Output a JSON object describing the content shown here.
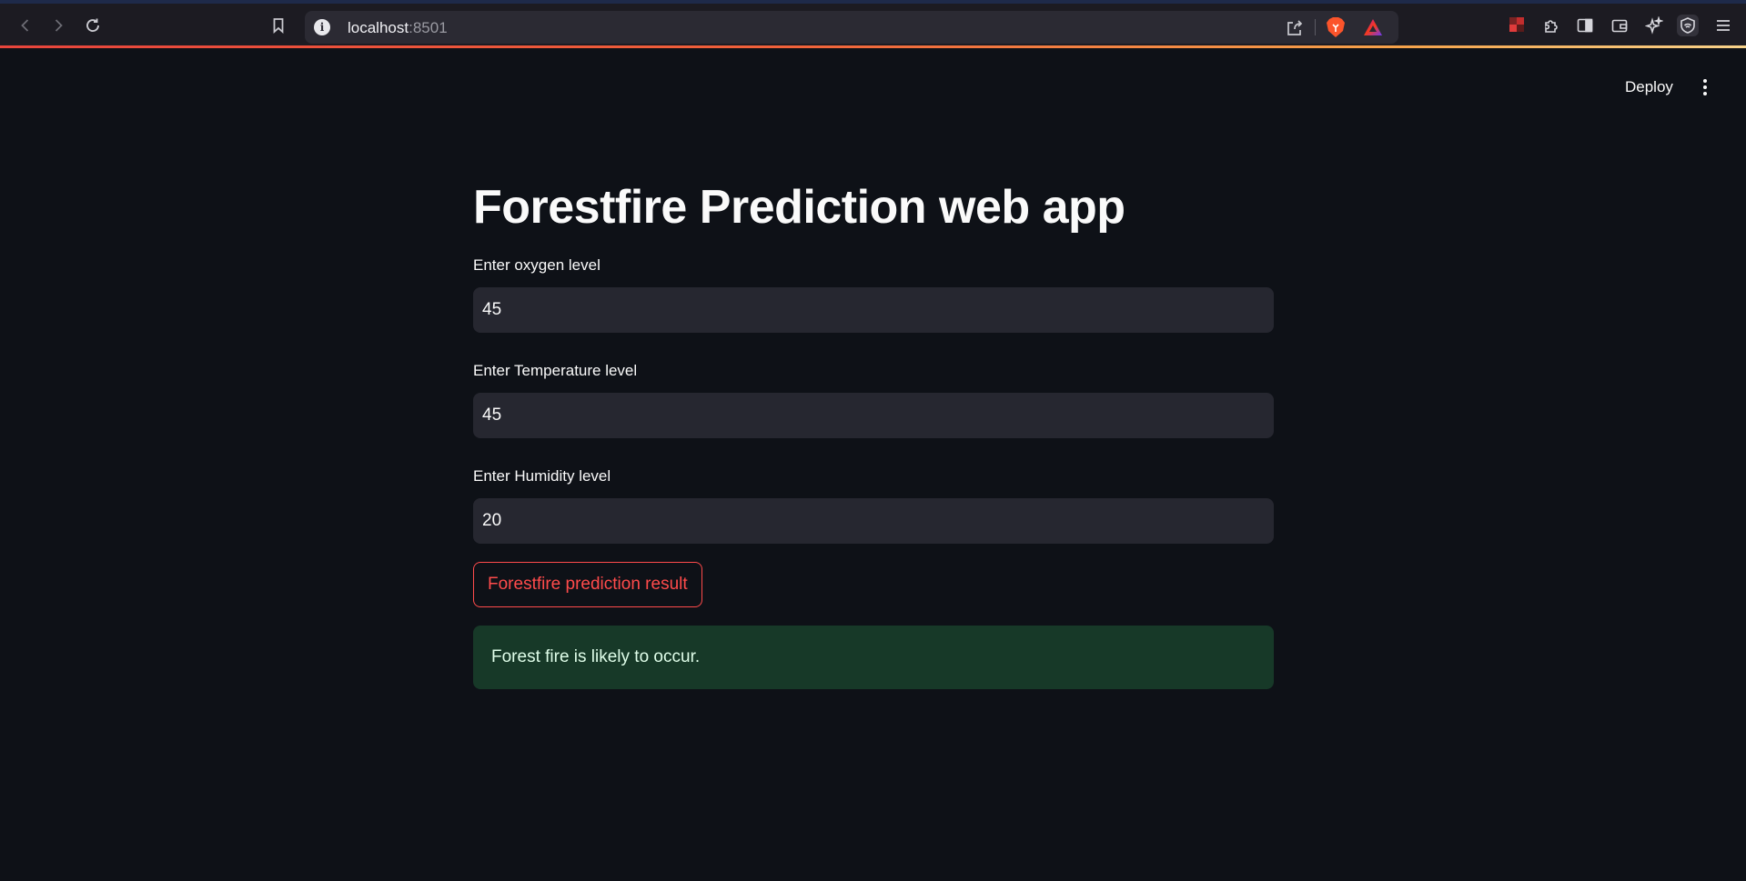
{
  "browser": {
    "url_host": "localhost",
    "url_port": ":8501"
  },
  "app": {
    "deploy_label": "Deploy",
    "title": "Forestfire Prediction web app",
    "fields": [
      {
        "label": "Enter oxygen level",
        "value": "45"
      },
      {
        "label": "Enter Temperature level",
        "value": "45"
      },
      {
        "label": "Enter Humidity level",
        "value": "20"
      }
    ],
    "button_label": "Forestfire prediction result",
    "result_text": "Forest fire is likely to occur."
  },
  "colors": {
    "background": "#0e1117",
    "input_bg": "#262730",
    "accent": "#ff4b4b",
    "success_bg": "#173928",
    "success_text": "#dffde9"
  },
  "icons": [
    "back-icon",
    "forward-icon",
    "reload-icon",
    "bookmark-icon",
    "site-info-icon",
    "share-icon",
    "brave-shields-icon",
    "brave-rewards-icon",
    "extension-pixel-icon",
    "extensions-icon",
    "sidebar-icon",
    "wallet-icon",
    "leo-ai-icon",
    "vpn-icon",
    "menu-icon",
    "kebab-menu-icon"
  ]
}
